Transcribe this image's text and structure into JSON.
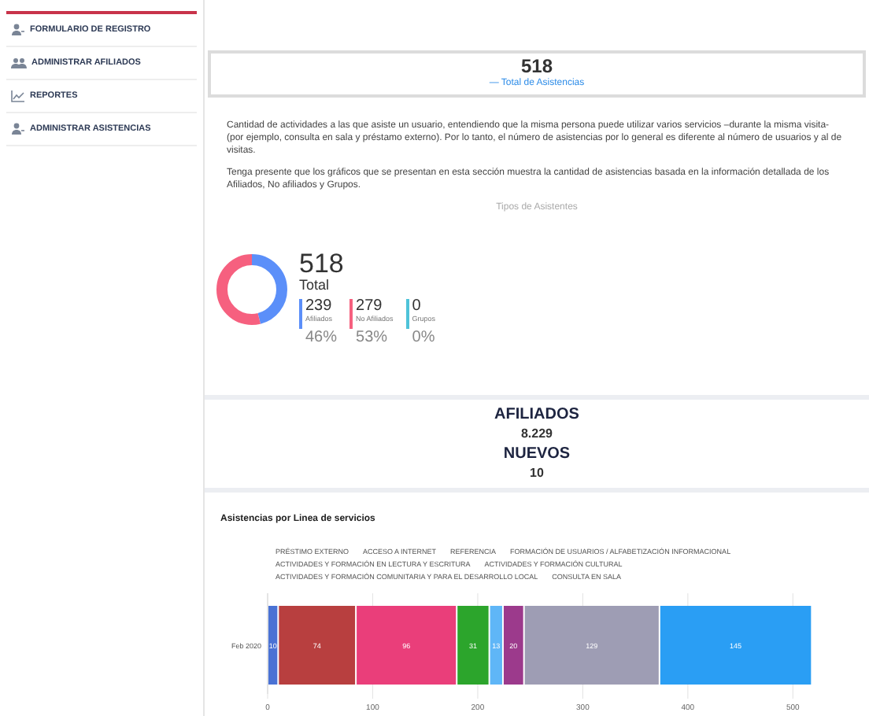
{
  "sidebar": {
    "items": [
      {
        "label": "FORMULARIO DE REGISTRO",
        "kind": "user"
      },
      {
        "label": "ADMINISTRAR AFILIADOS",
        "kind": "users"
      },
      {
        "label": "REPORTES",
        "kind": "chart"
      },
      {
        "label": "ADMINISTRAR ASISTENCIAS",
        "kind": "user"
      }
    ]
  },
  "summary": {
    "value": "518",
    "label": "— Total de Asistencias"
  },
  "paragraphs": [
    "Cantidad de actividades a las que asiste un usuario, entendiendo que la misma persona puede utilizar varios servicios –durante la misma visita- (por ejemplo, consulta en sala y préstamo externo). Por lo tanto, el número de asistencias por lo general es diferente al número de usuarios y al de visitas.",
    "Tenga presente que los gráficos que se presentan en esta sección muestra la cantidad de asistencias basada en la información detallada de los Afiliados, No afiliados y Grupos."
  ],
  "types": {
    "title": "Tipos de Asistentes",
    "total": "518",
    "total_label": "Total",
    "items": [
      {
        "value": "239",
        "label": "Afiliados",
        "percent": "46%",
        "color": "#5b8ff9",
        "level": 0.46
      },
      {
        "value": "279",
        "label": "No Afiliados",
        "percent": "53%",
        "color": "#f6607f",
        "level": 0.54
      },
      {
        "value": "0",
        "label": "Grupos",
        "percent": "0%",
        "color": "#4fc3d9",
        "level": 0
      }
    ]
  },
  "counts": [
    {
      "label": "AFILIADOS",
      "value": "8.229"
    },
    {
      "label": "NUEVOS",
      "value": "10"
    }
  ],
  "services": {
    "title": "Asistencias por Linea de servicios",
    "chart_data": {
      "type": "bar",
      "orientation": "horizontal",
      "stacked": true,
      "categories": [
        "Feb 2020"
      ],
      "xlim": [
        0,
        520
      ],
      "xticks": [
        0,
        100,
        200,
        300,
        400,
        500
      ],
      "grid": true,
      "data_labels": true,
      "series": [
        {
          "name": "PRÉSTIMO EXTERNO",
          "color": "#4a72d4",
          "values": [
            10
          ]
        },
        {
          "name": "ACCESO A INTERNET",
          "color": "#b83f3f",
          "values": [
            74
          ]
        },
        {
          "name": "REFERENCIA",
          "color": "#ea3e7a",
          "values": [
            96
          ]
        },
        {
          "name": "FORMACIÓN DE USUARIOS / ALFABETIZACIÓN INFORMACIONAL",
          "color": "#2ca52c",
          "values": [
            31
          ]
        },
        {
          "name": "ACTIVIDADES Y FORMACIÓN EN LECTURA Y ESCRITURA",
          "color": "#5fb6f7",
          "values": [
            13
          ]
        },
        {
          "name": "ACTIVIDADES Y FORMACIÓN CULTURAL",
          "color": "#9c3a8c",
          "values": [
            20
          ]
        },
        {
          "name": "ACTIVIDADES Y FORMACIÓN COMUNITARIA Y PARA EL DESARROLLO LOCAL",
          "color": "#9e9db4",
          "values": [
            129
          ]
        },
        {
          "name": "CONSULTA EN SALA",
          "color": "#2a9ef4",
          "values": [
            145
          ]
        }
      ]
    }
  }
}
